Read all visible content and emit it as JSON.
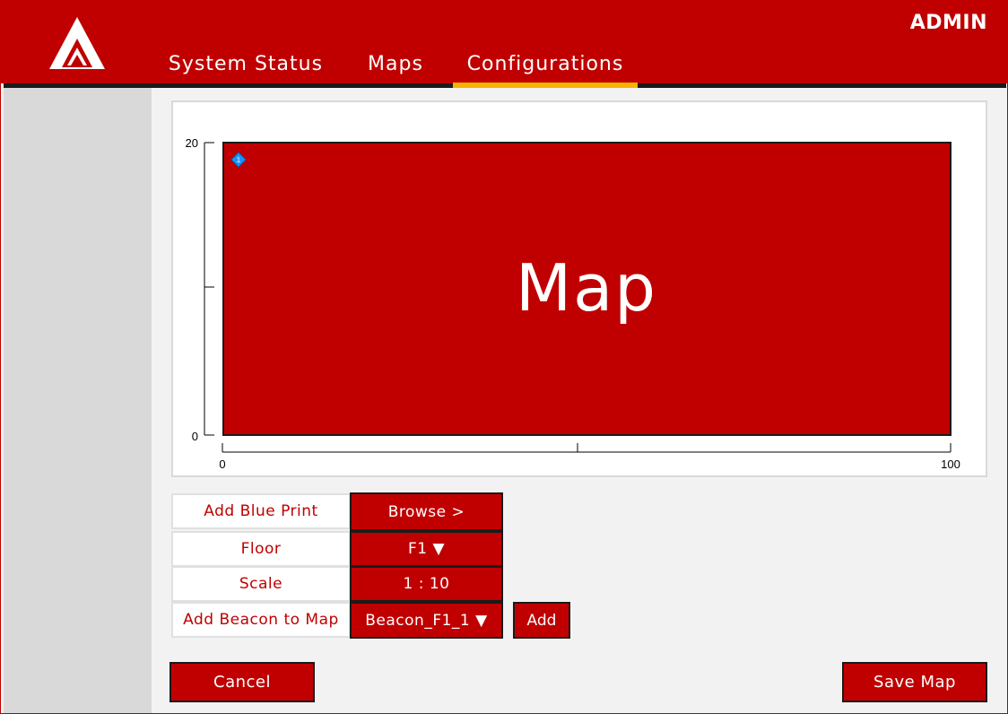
{
  "header": {
    "user_label": "ADMIN",
    "tabs": [
      {
        "label": "System Status",
        "active": false
      },
      {
        "label": "Maps",
        "active": false
      },
      {
        "label": "Configurations",
        "active": true
      }
    ]
  },
  "map": {
    "placeholder_text": "Map",
    "y_axis": {
      "min_label": "0",
      "max_label": "20"
    },
    "x_axis": {
      "min_label": "0",
      "max_label": "100"
    },
    "beacon_marker": {
      "label": "1",
      "color": "#1e90ff"
    }
  },
  "config": {
    "blueprint": {
      "label": "Add Blue Print",
      "button": "Browse >"
    },
    "floor": {
      "label": "Floor",
      "value": "F1 ▼"
    },
    "scale": {
      "label": "Scale",
      "value": "1 : 10"
    },
    "beacon": {
      "label": "Add Beacon to Map",
      "value": "Beacon_F1_1 ▼",
      "add_button": "Add"
    }
  },
  "actions": {
    "cancel": "Cancel",
    "save": "Save Map"
  },
  "colors": {
    "brand_red": "#c00000",
    "accent_yellow": "#f5b400",
    "sidebar_gray": "#d9d9d9"
  }
}
